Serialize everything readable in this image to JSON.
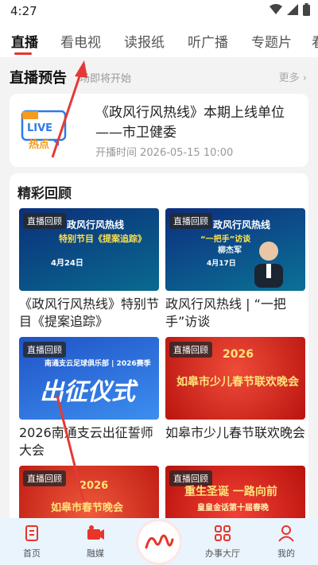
{
  "status": {
    "time": "4:27"
  },
  "tabs": [
    {
      "label": "直播"
    },
    {
      "label": "看电视"
    },
    {
      "label": "读报纸"
    },
    {
      "label": "听广播"
    },
    {
      "label": "专题片"
    },
    {
      "label": "看"
    }
  ],
  "preview": {
    "title": "直播预告",
    "subtitle": "场即将开始",
    "more": "更多",
    "icon_text_top": "LIVE",
    "icon_text_bottom": "热点",
    "card_title": "《政风行风热线》本期上线单位——市卫健委",
    "card_time": "开播时间 2026-05-15 10:00"
  },
  "highlights": {
    "title": "精彩回顾",
    "badge": "直播回顾",
    "items": [
      {
        "title": "《政风行风热线》特别节目《提案追踪》",
        "thumb_title": "政风行风热线",
        "thumb_sub": "特别节目《提案追踪》",
        "thumb_date": "4月24日"
      },
      {
        "title": "政风行风热线 | “一把手”访谈",
        "thumb_title": "政风行风热线",
        "thumb_sub": "“一把手”访谈",
        "thumb_name": "柳杰军",
        "thumb_date": "4月17日"
      },
      {
        "title": "2026南通支云出征誓师大会",
        "thumb_title": "出征仪式",
        "thumb_sub": "南通支云足球俱乐部 | 2026赛季"
      },
      {
        "title": "如皋市少儿春节联欢晚会",
        "thumb_title": "如皋市少儿春节联欢晚会",
        "thumb_sub": "2026"
      },
      {
        "title": "",
        "thumb_title": "如皋市春节晚会",
        "thumb_sub": "2026"
      },
      {
        "title": "",
        "thumb_title": "重生圣诞 一路向前",
        "thumb_sub": "皇皇金话第十届春晚"
      }
    ]
  },
  "bottom_nav": [
    {
      "label": "首页",
      "icon": "home-icon"
    },
    {
      "label": "融媒",
      "icon": "camera-icon"
    },
    {
      "label": "",
      "icon": "center-logo-icon"
    },
    {
      "label": "办事大厅",
      "icon": "grid-icon"
    },
    {
      "label": "我的",
      "icon": "user-icon"
    }
  ],
  "colors": {
    "accent": "#e8342b",
    "live_blue": "#2d7ce8",
    "live_orange": "#f39c1f"
  }
}
